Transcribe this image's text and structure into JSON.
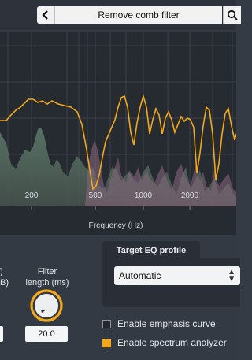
{
  "header": {
    "title": "Remove comb filter",
    "back_icon": "chevron-left-icon",
    "search_icon": "search-icon"
  },
  "chart_data": {
    "type": "area",
    "x_axis": {
      "label": "Frequency (Hz)",
      "scale": "log",
      "ticks": [
        {
          "value": 200,
          "label": "200"
        },
        {
          "value": 500,
          "label": "500"
        },
        {
          "value": 1000,
          "label": "1000"
        },
        {
          "value": 2000,
          "label": "2000"
        }
      ]
    },
    "grid": true,
    "series": [
      {
        "style": "line",
        "color": "#f2a818"
      },
      {
        "style": "filled area",
        "color": "#4f6a5c"
      },
      {
        "style": "filled area",
        "color": "#8a6a80"
      }
    ]
  },
  "controls": {
    "left_col_label_a": ")",
    "left_col_label_b": "B)",
    "filter_length_label_a": "Filter",
    "filter_length_label_b": "length (ms)",
    "filter_length_value": "20.0",
    "filter_length_knob_icon": "knob-icon"
  },
  "eq_profile": {
    "tab_label": "Target EQ profile",
    "selected": "Automatic"
  },
  "options": {
    "emphasis_label": "Enable emphasis curve",
    "emphasis_checked": false,
    "analyzer_label": "Enable spectrum analyzer",
    "analyzer_checked": true
  },
  "colors": {
    "accent": "#f2a818",
    "background": "#353b44",
    "chart_background": "#262a31"
  }
}
